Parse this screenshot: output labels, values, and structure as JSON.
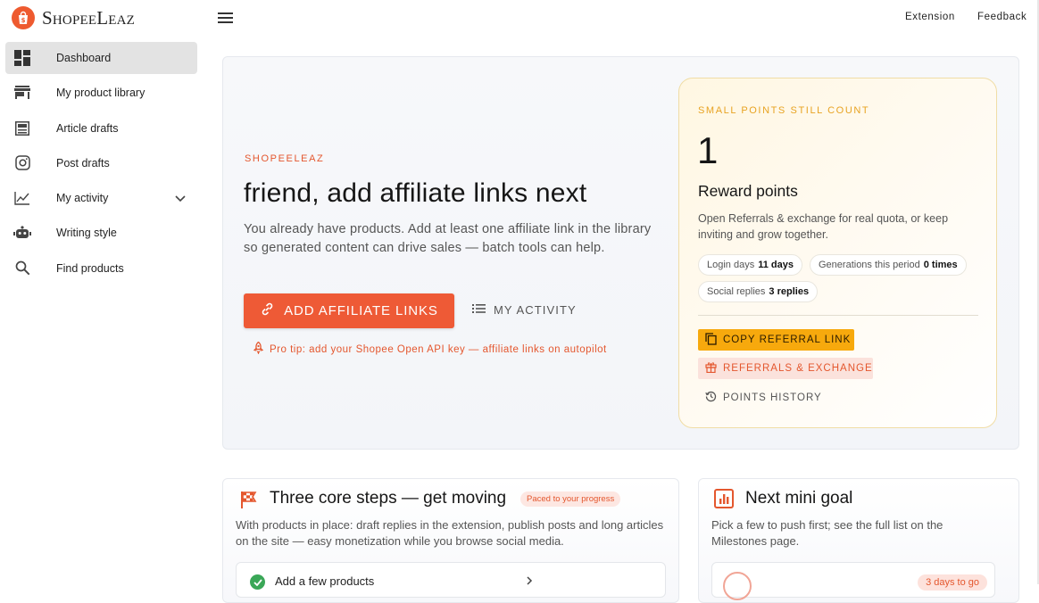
{
  "brand": {
    "name": "ShopeeLeaz"
  },
  "nav": {
    "items": [
      {
        "label": "Dashboard",
        "icon": "dashboard-icon",
        "active": true
      },
      {
        "label": "My product library",
        "icon": "store-icon"
      },
      {
        "label": "Article drafts",
        "icon": "article-icon"
      },
      {
        "label": "Post drafts",
        "icon": "instagram-icon"
      },
      {
        "label": "My activity",
        "icon": "chart-line-icon",
        "expandable": true
      },
      {
        "label": "Writing style",
        "icon": "robot-icon"
      },
      {
        "label": "Find products",
        "icon": "search-icon"
      }
    ]
  },
  "topbar": {
    "extension": "Extension",
    "feedback": "Feedback"
  },
  "hero": {
    "eyebrow": "SHOPEELEAZ",
    "title": "friend, add affiliate links next",
    "description": "You already have products. Add at least one affiliate link in the library so generated content can drive sales — batch tools can help.",
    "primary_button": "ADD AFFILIATE LINKS",
    "secondary_button": "MY ACTIVITY",
    "tip": "Pro tip: add your Shopee Open API key — affiliate links on autopilot"
  },
  "points": {
    "eyebrow": "SMALL POINTS STILL COUNT",
    "value": "1",
    "title": "Reward points",
    "description": "Open Referrals & exchange for real quota, or keep inviting and grow together.",
    "chips": {
      "login_label": "Login days",
      "login_value": "11 days",
      "gen_label": "Generations this period",
      "gen_value": "0 times",
      "social_label": "Social replies",
      "social_value": "3 replies"
    },
    "copy_button": "COPY REFERRAL LINK",
    "referrals_button": "REFERRALS & EXCHANGE",
    "history_button": "POINTS HISTORY"
  },
  "steps_card": {
    "title": "Three core steps — get moving",
    "pill": "Paced to your progress",
    "description": "With products in place: draft replies in the extension, publish posts and long articles on the site — easy monetization while you browse social media.",
    "first_step": "Add a few products"
  },
  "goal_card": {
    "title": "Next mini goal",
    "description": "Pick a few to push first; see the full list on the Milestones page.",
    "badge": "3 days to go"
  },
  "colors": {
    "accent": "#ee5a36",
    "gold": "#f7a90d",
    "success": "#3aa757"
  }
}
